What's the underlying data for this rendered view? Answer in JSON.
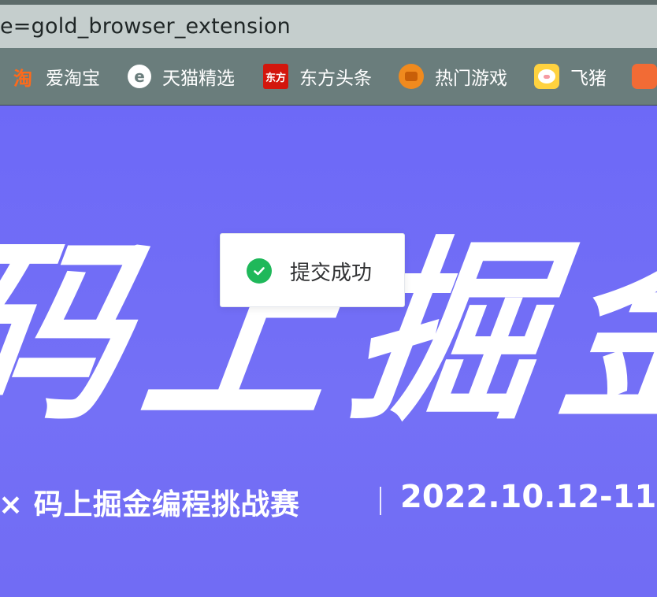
{
  "browser": {
    "address_text": "e=gold_browser_extension",
    "bookmarks": [
      {
        "label": "爱淘宝",
        "icon": "taobao-icon",
        "glyph": "淘"
      },
      {
        "label": "天猫精选",
        "icon": "tmall-icon",
        "glyph": "e"
      },
      {
        "label": "东方头条",
        "icon": "dongfang-icon",
        "glyph": "东方"
      },
      {
        "label": "热门游戏",
        "icon": "game-icon",
        "glyph": ""
      },
      {
        "label": "飞猪",
        "icon": "feizhu-icon",
        "glyph": ""
      },
      {
        "label": "",
        "icon": "app-icon",
        "glyph": ""
      }
    ]
  },
  "banner": {
    "title": "码上掘金",
    "subtitle": "× 码上掘金编程挑战赛",
    "date": "2022.10.12-11"
  },
  "toast": {
    "message": "提交成功",
    "icon": "check-circle-icon",
    "color": "#1fb85a"
  },
  "colors": {
    "banner_bg": "#6e6af6",
    "bookmarks_bar": "#6a7d7c",
    "address_bar": "#c5cecd"
  }
}
